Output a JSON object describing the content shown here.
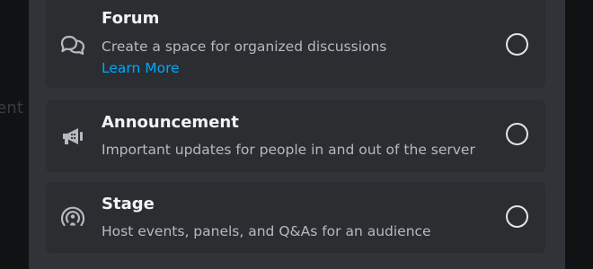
{
  "background": {
    "partial_text": "ent"
  },
  "options": [
    {
      "title": "Forum",
      "description": "Create a space for organized discussions",
      "link": "Learn More",
      "icon": "forum-icon"
    },
    {
      "title": "Announcement",
      "description": "Important updates for people in and out of the server",
      "icon": "megaphone-icon"
    },
    {
      "title": "Stage",
      "description": "Host events, panels, and Q&As for an audience",
      "icon": "stage-icon"
    }
  ],
  "colors": {
    "surface": "#313338",
    "card": "#2b2d31",
    "text_primary": "#f2f3f5",
    "text_secondary": "#b5bac1",
    "link": "#00a8fc"
  }
}
